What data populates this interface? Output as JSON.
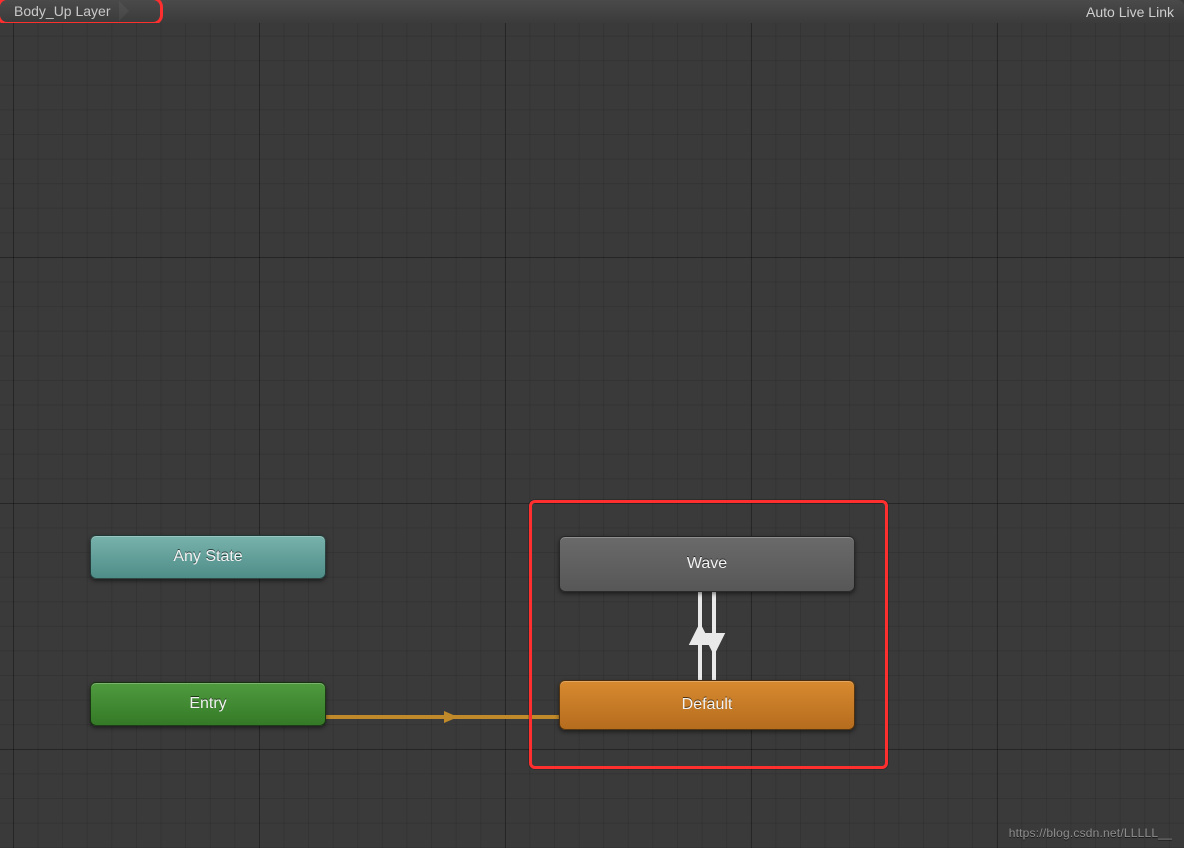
{
  "toolbar": {
    "breadcrumb": "Body_Up Layer",
    "right_button": "Auto Live Link"
  },
  "nodes": {
    "any_state": {
      "label": "Any State"
    },
    "entry": {
      "label": "Entry"
    },
    "wave": {
      "label": "Wave"
    },
    "default": {
      "label": "Default"
    }
  },
  "colors": {
    "highlight": "#ff2f2f",
    "entry_edge": "#c08a2a",
    "transition_edge": "#e9e9e9"
  },
  "watermark": "https://blog.csdn.net/LLLLL__"
}
